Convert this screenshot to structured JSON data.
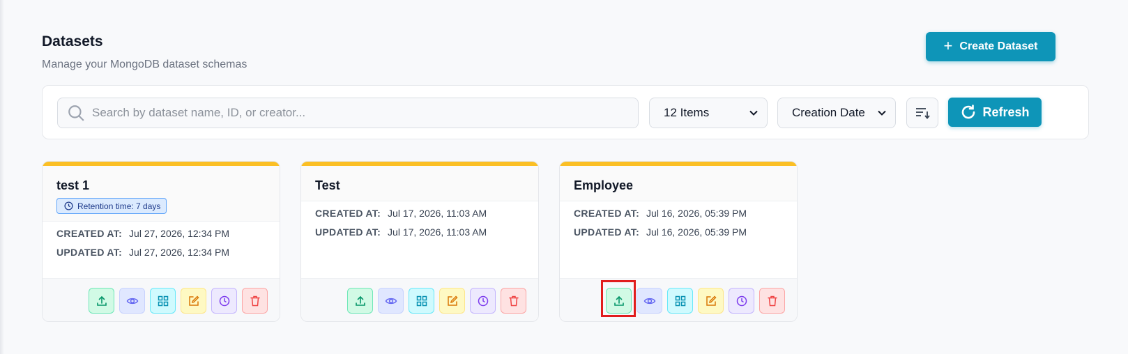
{
  "header": {
    "title": "Datasets",
    "subtitle": "Manage your MongoDB dataset schemas",
    "create_label": "Create Dataset"
  },
  "toolbar": {
    "search_placeholder": "Search by dataset name, ID, or creator...",
    "page_size": "12 Items",
    "sort_by": "Creation Date",
    "refresh_label": "Refresh"
  },
  "labels": {
    "created": "CREATED AT:",
    "updated": "UPDATED AT:"
  },
  "datasets": [
    {
      "name": "test 1",
      "retention": "Retention time: 7 days",
      "created_at": "Jul 27, 2026, 12:34 PM",
      "updated_at": "Jul 27, 2026, 12:34 PM"
    },
    {
      "name": "Test",
      "created_at": "Jul 17, 2026, 11:03 AM",
      "updated_at": "Jul 17, 2026, 11:03 AM"
    },
    {
      "name": "Employee",
      "created_at": "Jul 16, 2026, 05:39 PM",
      "updated_at": "Jul 16, 2026, 05:39 PM"
    }
  ],
  "colors": {
    "accent": "#0e95b8",
    "card_top_bar": "#fbbf24",
    "highlight": "#e11d1d"
  },
  "icons": [
    "search-icon",
    "plus-icon",
    "chevron-down-icon",
    "sort-icon",
    "refresh-icon",
    "clock-icon",
    "upload-icon",
    "eye-icon",
    "grid-icon",
    "edit-icon",
    "history-icon",
    "trash-icon"
  ]
}
